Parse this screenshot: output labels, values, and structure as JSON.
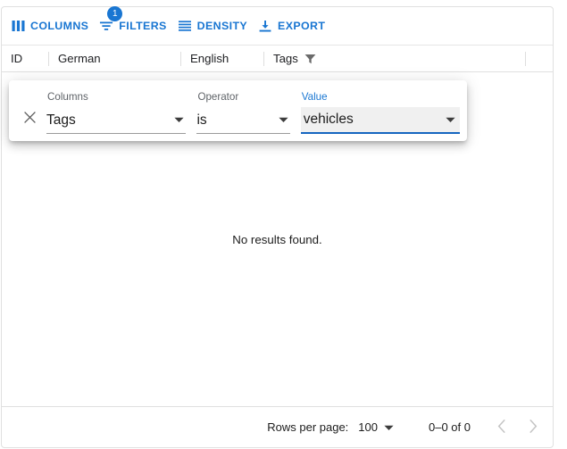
{
  "toolbar": {
    "columns_label": "COLUMNS",
    "filters_label": "FILTERS",
    "filters_badge": "1",
    "density_label": "DENSITY",
    "export_label": "EXPORT",
    "accent_color": "#1976d2"
  },
  "grid": {
    "columns": [
      {
        "id": "id",
        "label": "ID",
        "filtered": false
      },
      {
        "id": "german",
        "label": "German",
        "filtered": false
      },
      {
        "id": "english",
        "label": "English",
        "filtered": false
      },
      {
        "id": "tags",
        "label": "Tags",
        "filtered": true
      }
    ],
    "empty_message": "No results found."
  },
  "filter_panel": {
    "columns_label": "Columns",
    "columns_value": "Tags",
    "operator_label": "Operator",
    "operator_value": "is",
    "value_label": "Value",
    "value_value": "vehicles",
    "value_focused": true
  },
  "footer": {
    "rows_per_page_label": "Rows per page:",
    "rows_per_page_value": "100",
    "range_label": "0–0 of 0",
    "prev_enabled": false,
    "next_enabled": false
  }
}
